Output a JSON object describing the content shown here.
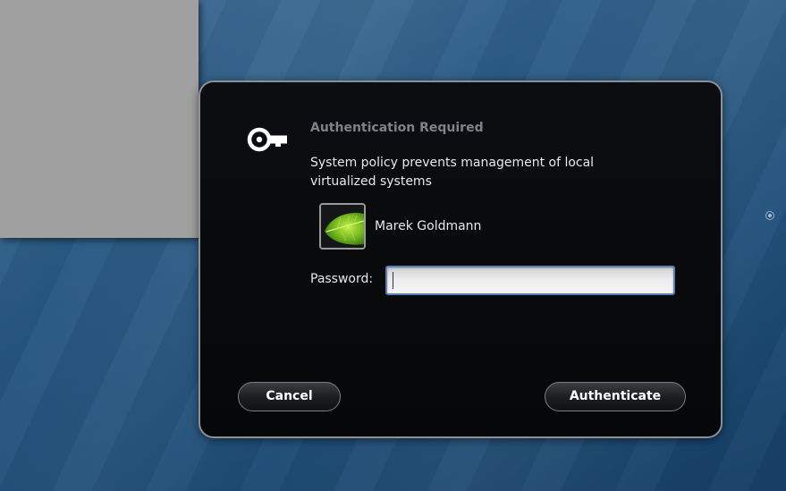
{
  "dialog": {
    "title": "Authentication Required",
    "message": "System policy prevents management of local virtualized systems",
    "icon": "key-icon",
    "user": {
      "name": "Marek Goldmann",
      "avatar": "leaf-avatar"
    },
    "password": {
      "label": "Password:",
      "value": "",
      "placeholder": ""
    },
    "buttons": {
      "cancel": "Cancel",
      "authenticate": "Authenticate"
    }
  },
  "colors": {
    "desktop_background": "#1f4e78",
    "dialog_background": "#080a0c",
    "dialog_border": "#8c8f93",
    "title_text": "#7e8288",
    "body_text": "#e8e8e8",
    "input_focus_border": "#5a7fb5",
    "background_window": "#a0a0a0"
  }
}
